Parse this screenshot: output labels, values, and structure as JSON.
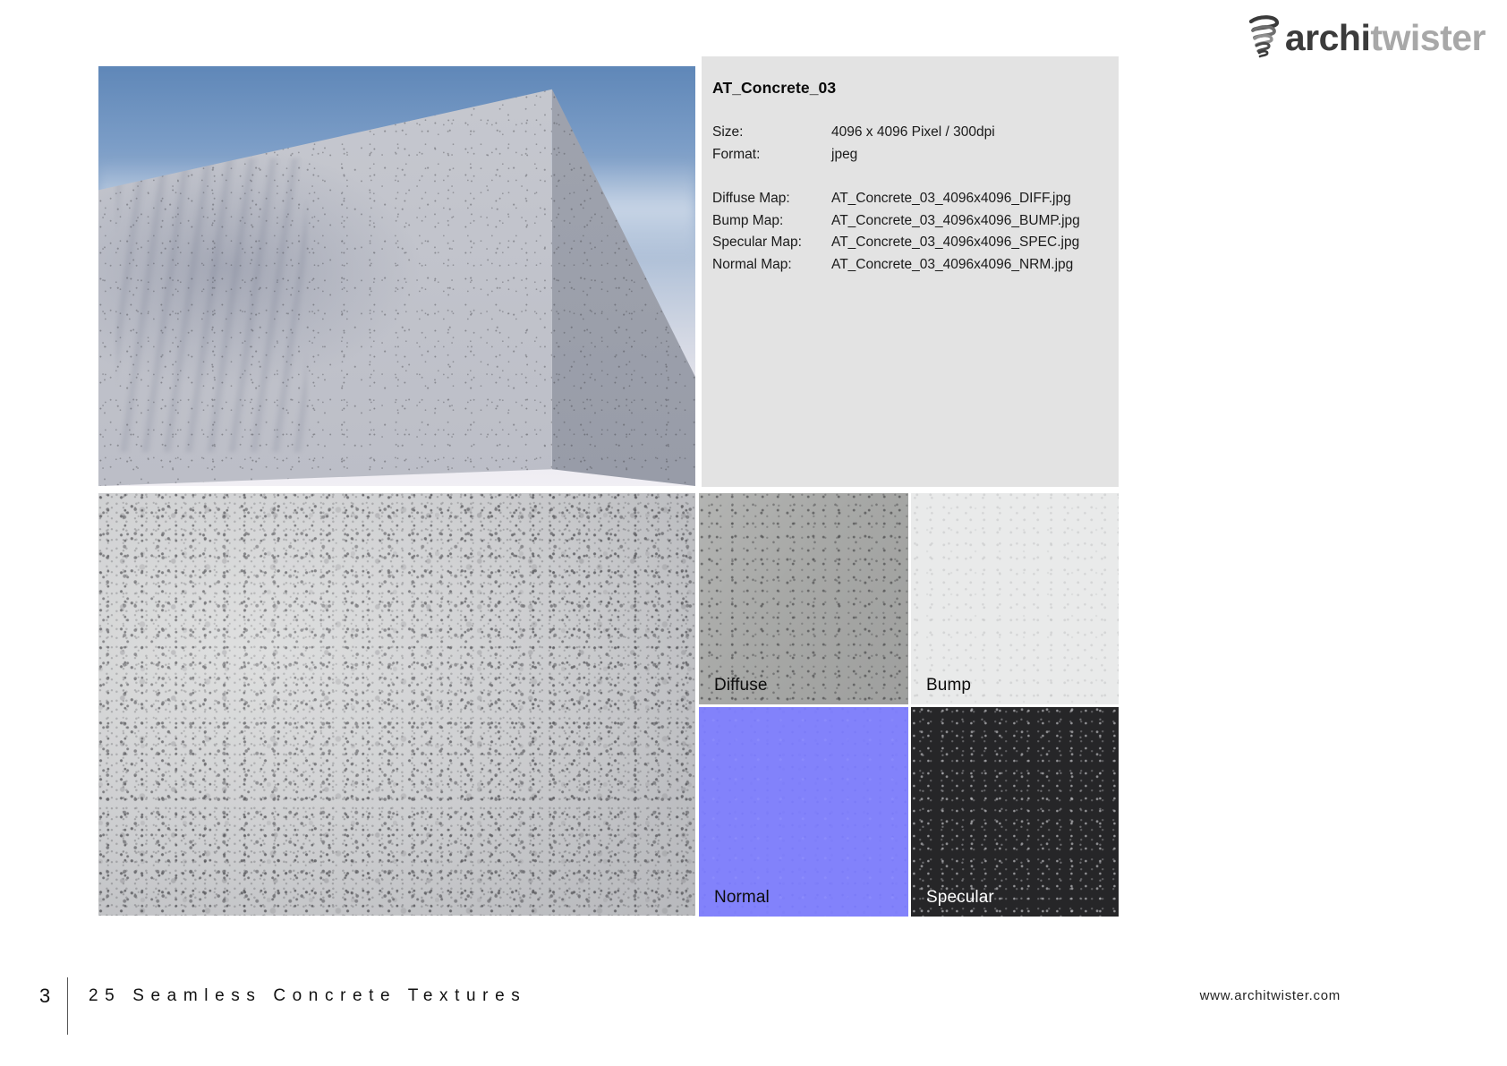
{
  "brand": {
    "logo_text_primary": "archi",
    "logo_text_secondary": "twister",
    "logo_icon": "spiral-twister-icon"
  },
  "info_panel": {
    "title": "AT_Concrete_03",
    "rows": [
      {
        "key": "Size:",
        "value": "4096 x 4096 Pixel / 300dpi"
      },
      {
        "key": "Format:",
        "value": "jpeg"
      }
    ],
    "map_rows": [
      {
        "key": "Diffuse Map:",
        "value": "AT_Concrete_03_4096x4096_DIFF.jpg"
      },
      {
        "key": "Bump Map:",
        "value": "AT_Concrete_03_4096x4096_BUMP.jpg"
      },
      {
        "key": "Specular Map:",
        "value": "AT_Concrete_03_4096x4096_SPEC.jpg"
      },
      {
        "key": "Normal Map:",
        "value": "AT_Concrete_03_4096x4096_NRM.jpg"
      }
    ]
  },
  "previews": {
    "hero_alt": "concrete-block-render",
    "large_texture_alt": "concrete-seamless-texture-closeup",
    "maps": [
      {
        "label": "Diffuse",
        "name": "diffuse-map-thumbnail",
        "color": "#a7a8a6",
        "text_color": "#0d0d0d"
      },
      {
        "label": "Bump",
        "name": "bump-map-thumbnail",
        "color": "#e9eaea",
        "text_color": "#0d0d0d"
      },
      {
        "label": "Normal",
        "name": "normal-map-thumbnail",
        "color": "#8282fb",
        "text_color": "#0d0d0d"
      },
      {
        "label": "Specular",
        "name": "specular-map-thumbnail",
        "color": "#262628",
        "text_color": "#ffffff"
      }
    ]
  },
  "footer": {
    "page_number": "3",
    "title": "25 Seamless Concrete Textures",
    "url": "www.architwister.com"
  },
  "colors": {
    "panel_background": "#e3e3e3",
    "page_background": "#ffffff",
    "logo_dark": "#3b3b3b",
    "logo_light": "#a8a8a8"
  }
}
